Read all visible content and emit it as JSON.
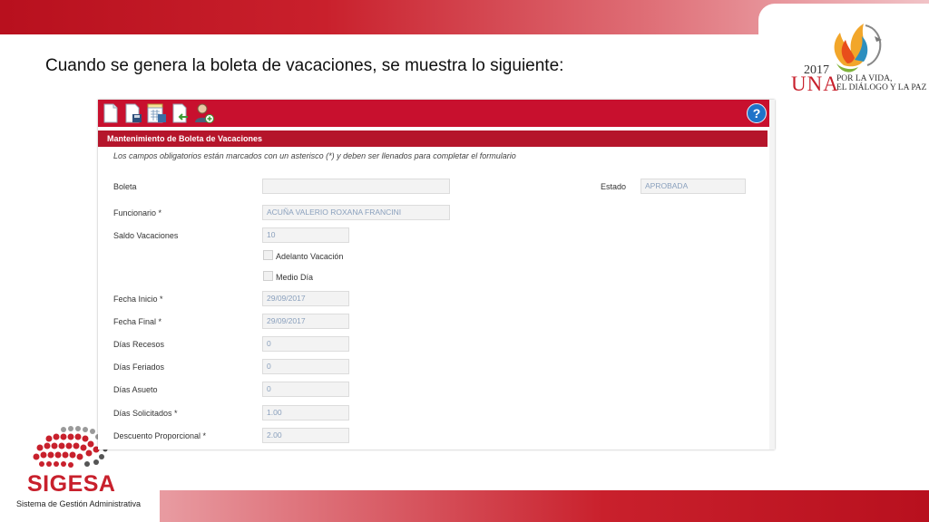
{
  "slide": {
    "title": "Cuando se genera la boleta de vacaciones, se muestra lo siguiente:",
    "una_logo": {
      "year": "2017",
      "name": "UNA",
      "motto_line1": "POR LA VIDA,",
      "motto_line2": "EL DIÁLOGO Y LA PAZ"
    },
    "sigesa_logo": {
      "name": "SIGESA",
      "subtitle": "Sistema de Gestión Administrativa"
    }
  },
  "toolbar": {
    "buttons": [
      {
        "name": "new-document-icon"
      },
      {
        "name": "save-document-icon"
      },
      {
        "name": "calendar-report-icon"
      },
      {
        "name": "document-back-icon"
      },
      {
        "name": "add-user-icon"
      }
    ],
    "help_label": "?"
  },
  "panel": {
    "title": "Mantenimiento de Boleta de Vacaciones",
    "notice": "Los campos obligatorios están marcados con un asterisco (*) y deben ser llenados para completar el formulario"
  },
  "form": {
    "boleta": {
      "label": "Boleta",
      "value": ""
    },
    "estado": {
      "label": "Estado",
      "value": "APROBADA"
    },
    "funcionario": {
      "label": "Funcionario  *",
      "value": "ACUÑA  VALERIO ROXANA FRANCINI"
    },
    "saldo": {
      "label": "Saldo Vacaciones",
      "value": "10"
    },
    "adelanto": {
      "label": "Adelanto Vacación",
      "checked": false
    },
    "medio_dia": {
      "label": "Medio Día",
      "checked": false
    },
    "fecha_inicio": {
      "label": "Fecha Inicio  *",
      "value": "29/09/2017"
    },
    "fecha_final": {
      "label": "Fecha Final  *",
      "value": "29/09/2017"
    },
    "dias_recesos": {
      "label": "Días Recesos",
      "value": "0"
    },
    "dias_feriados": {
      "label": "Días Feriados",
      "value": "0"
    },
    "dias_asueto": {
      "label": "Días Asueto",
      "value": "0"
    },
    "dias_solicitados": {
      "label": "Días Solicitados  *",
      "value": "1.00"
    },
    "descuento": {
      "label": "Descuento Proporcional  *",
      "value": "2.00"
    }
  },
  "colors": {
    "brand_red": "#c8102e",
    "header_red": "#b5152b",
    "help_blue": "#1f73c8"
  }
}
